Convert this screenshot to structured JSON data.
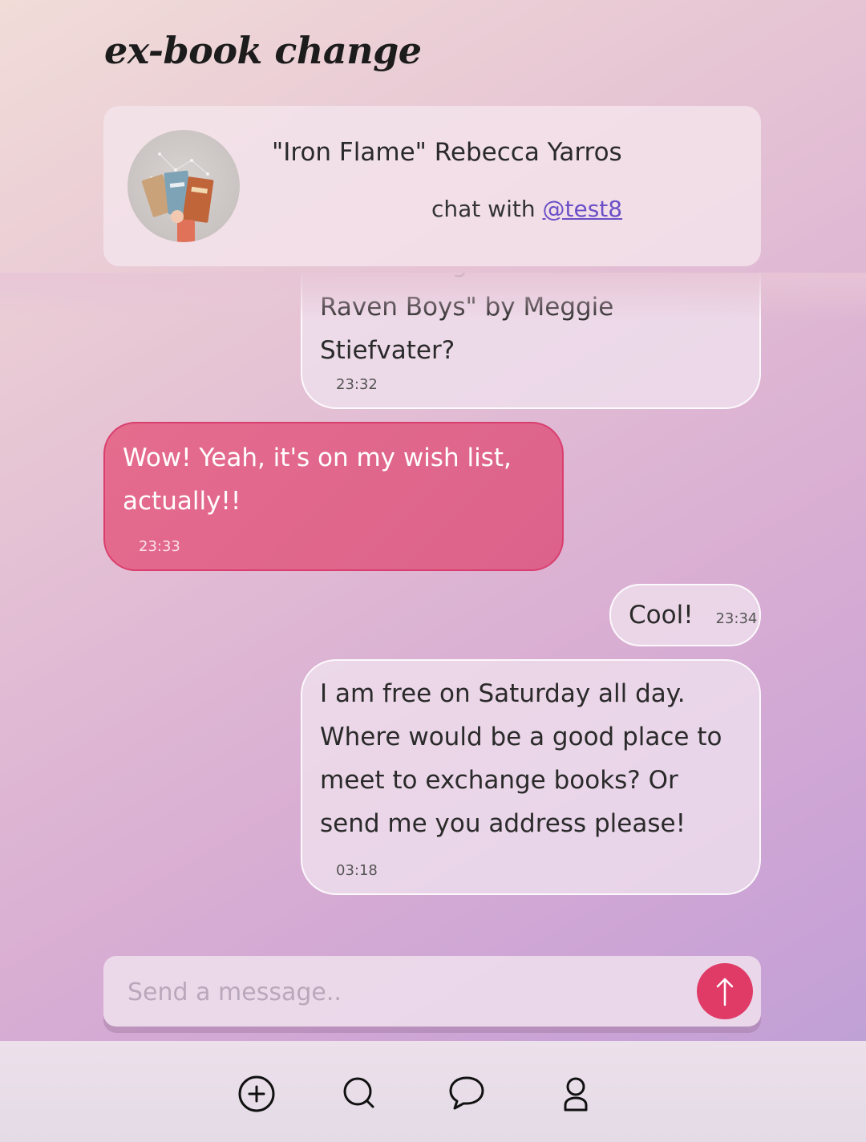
{
  "app": {
    "title": "ex-book change"
  },
  "book": {
    "title": "\"Iron Flame\" Rebecca Yarros",
    "chat_with_prefix": "chat with",
    "partner_handle": "@test8",
    "thumbnail_icon": "book-cover-photo"
  },
  "messages": [
    {
      "direction": "sent",
      "text": "Can I change this book on \"The Raven Boys\" by Meggie Stiefvater?",
      "time": "23:32"
    },
    {
      "direction": "received",
      "text": "Wow! Yeah, it's on my wish list, actually!!",
      "time": "23:33"
    },
    {
      "direction": "sent",
      "text": "Cool!",
      "time": "23:34"
    },
    {
      "direction": "sent",
      "text": "I am free on Saturday all day. Where would be a good place to meet to exchange books? Or send me you address please!",
      "time": "03:18"
    }
  ],
  "composer": {
    "placeholder": "Send a message..",
    "send_icon": "arrow-up-icon"
  },
  "nav": {
    "items": [
      {
        "icon": "add-circle-icon"
      },
      {
        "icon": "search-icon"
      },
      {
        "icon": "chat-bubble-icon"
      },
      {
        "icon": "profile-icon"
      }
    ]
  },
  "colors": {
    "accent": "#e03b67",
    "received_bubble": "#e0668c",
    "link": "#6a4fc7"
  }
}
